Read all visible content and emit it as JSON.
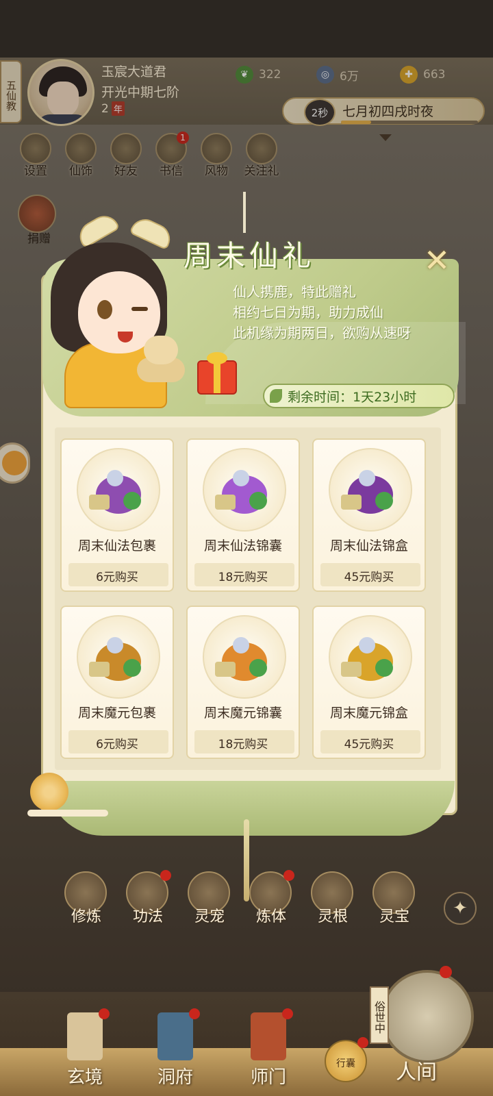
{
  "header": {
    "sect": "五仙教",
    "player_name": "玉宸大道君",
    "player_rank": "开光中期七阶",
    "player_age": "2",
    "player_age_unit": "年",
    "resources": [
      {
        "icon": "jade-leaf-icon",
        "value": "322"
      },
      {
        "icon": "coin-icon",
        "value": "6万"
      },
      {
        "icon": "strength-icon",
        "value": "663"
      }
    ],
    "time_badge": "2秒",
    "time_label": "七月初四戌时夜",
    "time_progress": 0.22
  },
  "top_icons": [
    {
      "label": "设置",
      "icon": "settings-icon",
      "badge": ""
    },
    {
      "label": "仙饰",
      "icon": "costume-icon",
      "badge": ""
    },
    {
      "label": "好友",
      "icon": "friends-icon",
      "badge": ""
    },
    {
      "label": "书信",
      "icon": "mail-icon",
      "badge": "1"
    },
    {
      "label": "风物",
      "icon": "scenery-icon",
      "badge": ""
    },
    {
      "label": "关注礼",
      "icon": "follow-gift-icon",
      "badge": ""
    }
  ],
  "donate_label": "捐赠",
  "popup": {
    "title": "周末仙礼",
    "lines": [
      "仙人携鹿，特此赠礼",
      "相约七日为期，助力成仙",
      "此机缘为期两日，欲购从速呀"
    ],
    "timer": "剩余时间：1天23小时",
    "close_icon": "close-icon",
    "items": [
      {
        "name": "周末仙法包裹",
        "price": "6元购买",
        "color": "#8e4db0"
      },
      {
        "name": "周末仙法锦囊",
        "price": "18元购买",
        "color": "#a25ad0"
      },
      {
        "name": "周末仙法锦盒",
        "price": "45元购买",
        "color": "#7b3a9e"
      },
      {
        "name": "周末魔元包裹",
        "price": "6元购买",
        "color": "#c98a2a"
      },
      {
        "name": "周末魔元锦囊",
        "price": "18元购买",
        "color": "#e08a2e"
      },
      {
        "name": "周末魔元锦盒",
        "price": "45元购买",
        "color": "#d9a42a"
      }
    ]
  },
  "functions": [
    {
      "label": "修炼",
      "badge": false
    },
    {
      "label": "功法",
      "badge": true
    },
    {
      "label": "灵宠",
      "badge": false
    },
    {
      "label": "炼体",
      "badge": true
    },
    {
      "label": "灵根",
      "badge": false
    },
    {
      "label": "灵宝",
      "badge": false
    }
  ],
  "nav": {
    "items": [
      {
        "label": "玄境",
        "color": "#d9c49a"
      },
      {
        "label": "洞府",
        "color": "#4a6e8a"
      },
      {
        "label": "师门",
        "color": "#b4502e"
      }
    ],
    "bag_label": "行囊",
    "world_tag": "俗世中",
    "world_label": "人间"
  }
}
